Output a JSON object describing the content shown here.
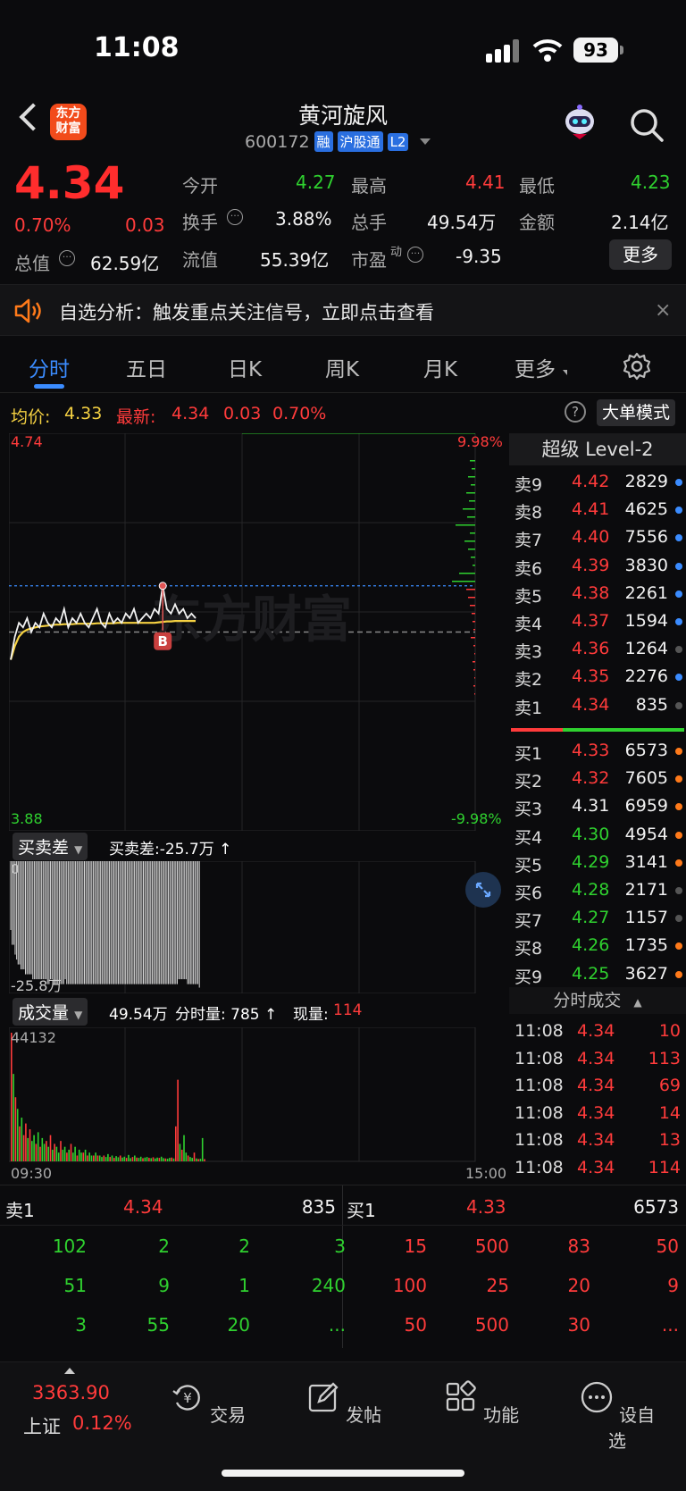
{
  "status": {
    "time": "11:08",
    "battery": "93"
  },
  "header": {
    "logo": "东方财富",
    "name": "黄河旋风",
    "code": "600172",
    "tags": [
      "融",
      "沪股通",
      "L2"
    ]
  },
  "quote": {
    "price": "4.34",
    "pct": "0.70%",
    "chg": "0.03",
    "open_label": "今开",
    "open": "4.27",
    "high_label": "最高",
    "high": "4.41",
    "low_label": "最低",
    "low": "4.23",
    "turnover_label": "换手",
    "turnover": "3.88%",
    "volume_label": "总手",
    "volume": "49.54万",
    "amount_label": "金额",
    "amount": "2.14亿",
    "mcap_label": "总值",
    "mcap": "62.59亿",
    "float_label": "流值",
    "float": "55.39亿",
    "pe_label": "市盈",
    "pe_sup": "动",
    "pe": "-9.35",
    "more": "更多"
  },
  "notice": {
    "text": "自选分析：触发重点关注信号，立即点击查看",
    "close": "×"
  },
  "tabs": [
    "分时",
    "五日",
    "日K",
    "周K",
    "月K",
    "更多"
  ],
  "avgbar": {
    "avg_label": "均价:",
    "avg": "4.33",
    "latest_label": "最新:",
    "latest": "4.34",
    "chg": "0.03",
    "pct": "0.70%",
    "help": "?",
    "big_mode": "大单模式"
  },
  "chart_data": {
    "type": "line",
    "y_top": "4.74",
    "y_bottom": "3.88",
    "pct_top": "9.98%",
    "pct_bottom": "-9.98%",
    "watermark": "东方财富",
    "buy_marker": "B",
    "ylim": [
      3.88,
      4.74
    ],
    "prev_close": 4.31,
    "price": [
      4.25,
      4.3,
      4.33,
      4.32,
      4.34,
      4.31,
      4.33,
      4.32,
      4.35,
      4.33,
      4.32,
      4.34,
      4.33,
      4.36,
      4.32,
      4.34,
      4.33,
      4.35,
      4.33,
      4.32,
      4.34,
      4.36,
      4.33,
      4.32,
      4.35,
      4.33,
      4.34,
      4.33,
      4.35,
      4.34,
      4.36,
      4.33,
      4.34,
      4.35,
      4.34,
      4.36,
      4.35,
      4.41,
      4.36,
      4.35,
      4.37,
      4.35,
      4.36,
      4.34,
      4.35,
      4.34
    ],
    "avg": [
      4.25,
      4.28,
      4.3,
      4.31,
      4.315,
      4.318,
      4.32,
      4.322,
      4.323,
      4.324,
      4.325,
      4.326,
      4.326,
      4.327,
      4.327,
      4.327,
      4.328,
      4.328,
      4.328,
      4.328,
      4.328,
      4.329,
      4.329,
      4.329,
      4.329,
      4.329,
      4.33,
      4.33,
      4.33,
      4.33,
      4.33,
      4.33,
      4.33,
      4.33,
      4.33,
      4.33,
      4.331,
      4.332,
      4.333,
      4.333,
      4.334,
      4.334,
      4.334,
      4.334,
      4.334,
      4.334
    ]
  },
  "diff": {
    "label": "买卖差",
    "text": "买卖差:-25.7万 ↑",
    "top_label": "0",
    "bottom_label": "-25.8万",
    "values": [
      -14,
      -17,
      -17,
      -19,
      -20,
      -21,
      -21,
      -22,
      -22,
      -22,
      -23,
      -23,
      -23,
      -23,
      -23,
      -24,
      -24,
      -24,
      -24,
      -24,
      -24,
      -24,
      -24,
      -24,
      -24,
      -25,
      -25,
      -24,
      -24,
      -25,
      -25,
      -25,
      -25,
      -25,
      -25,
      -25,
      -25,
      -24,
      -25,
      -25,
      -25,
      -25,
      -25,
      -25,
      -25,
      -25,
      -25,
      -25,
      -25,
      -25,
      -25,
      -25,
      -25,
      -25,
      -25,
      -25,
      -25,
      -25,
      -25,
      -25,
      -25,
      -25,
      -25,
      -25,
      -25,
      -25,
      -25,
      -25,
      -25,
      -25,
      -25,
      -25,
      -25,
      -25,
      -25,
      -25,
      -25,
      -25,
      -25,
      -25,
      -25,
      -25,
      -25,
      -25,
      -25,
      -25,
      -25,
      -25,
      -25,
      -25,
      -25,
      -25,
      -25,
      -25,
      -25,
      -25,
      -25,
      -25,
      -25,
      -25,
      -25,
      -25,
      -25,
      -25,
      -25,
      -25,
      -25,
      -25,
      -25,
      -25,
      -25,
      -25,
      -25,
      -25,
      -24,
      -24,
      -24,
      -24,
      -24,
      -24,
      -25,
      -25,
      -25,
      -25,
      -25,
      -25,
      -25,
      -25,
      -25.7
    ]
  },
  "volume": {
    "label": "成交量",
    "text_total": "49.54万",
    "text_seg": "分时量: 785 ↑",
    "text_now_label": "现量:",
    "text_now": "114",
    "max_label": "44132",
    "t_start": "09:30",
    "t_end": "15:00",
    "bars": [
      44132,
      30000,
      22000,
      18000,
      12000,
      15000,
      9000,
      13000,
      8000,
      11000,
      7000,
      9000,
      6000,
      10000,
      5000,
      8000,
      6000,
      7000,
      5000,
      9000,
      4000,
      6000,
      5000,
      3000,
      7000,
      4000,
      5000,
      3000,
      4000,
      6000,
      3000,
      5000,
      2000,
      4000,
      3000,
      3000,
      4000,
      2000,
      3000,
      2000,
      2000,
      3000,
      2000,
      2000,
      1500,
      2000,
      1500,
      2500,
      1500,
      2000,
      1200,
      1800,
      1400,
      2000,
      1300,
      1600,
      1200,
      2200,
      1100,
      1500,
      2000,
      1300,
      1200,
      1600,
      1100,
      1300,
      1500,
      1200,
      1100,
      1400,
      1000,
      1300,
      1200,
      1600,
      1100,
      1000,
      900,
      1200,
      1300,
      1000,
      12000,
      28000,
      6000,
      4000,
      9000,
      3000,
      2000,
      1500,
      1200,
      3000,
      1000,
      800,
      900,
      8000,
      785
    ],
    "dir": [
      1,
      0,
      1,
      0,
      1,
      0,
      1,
      1,
      0,
      1,
      0,
      0,
      1,
      0,
      1,
      0,
      0,
      1,
      0,
      1,
      0,
      1,
      0,
      0,
      1,
      0,
      0,
      1,
      0,
      1,
      0,
      0,
      1,
      0,
      0,
      1,
      0,
      1,
      0,
      0,
      1,
      0,
      1,
      0,
      0,
      1,
      0,
      0,
      1,
      0,
      1,
      0,
      0,
      1,
      0,
      0,
      1,
      0,
      0,
      1,
      0,
      1,
      0,
      0,
      1,
      0,
      0,
      1,
      0,
      1,
      0,
      0,
      1,
      0,
      0,
      1,
      0,
      0,
      1,
      0,
      1,
      1,
      0,
      1,
      0,
      0,
      1,
      0,
      0,
      1,
      0,
      1,
      0,
      0,
      1
    ]
  },
  "level2": {
    "title": "超级 Level-2",
    "asks": [
      {
        "label": "卖9",
        "price": "4.42",
        "vol": "2829",
        "dot": "#3b8cff"
      },
      {
        "label": "卖8",
        "price": "4.41",
        "vol": "4625",
        "dot": "#3b8cff"
      },
      {
        "label": "卖7",
        "price": "4.40",
        "vol": "7556",
        "dot": "#3b8cff"
      },
      {
        "label": "卖6",
        "price": "4.39",
        "vol": "3830",
        "dot": "#3b8cff"
      },
      {
        "label": "卖5",
        "price": "4.38",
        "vol": "2261",
        "dot": "#3b8cff"
      },
      {
        "label": "卖4",
        "price": "4.37",
        "vol": "1594",
        "dot": "#3b8cff"
      },
      {
        "label": "卖3",
        "price": "4.36",
        "vol": "1264",
        "dot": "#555"
      },
      {
        "label": "卖2",
        "price": "4.35",
        "vol": "2276",
        "dot": "#3b8cff"
      },
      {
        "label": "卖1",
        "price": "4.34",
        "vol": "835",
        "dot": "#555"
      }
    ],
    "bids": [
      {
        "label": "买1",
        "price": "4.33",
        "vol": "6573",
        "dot": "#ff7a1a",
        "color": "red"
      },
      {
        "label": "买2",
        "price": "4.32",
        "vol": "7605",
        "dot": "#ff7a1a",
        "color": "red"
      },
      {
        "label": "买3",
        "price": "4.31",
        "vol": "6959",
        "dot": "#ff7a1a",
        "color": "white"
      },
      {
        "label": "买4",
        "price": "4.30",
        "vol": "4954",
        "dot": "#ff7a1a",
        "color": "green"
      },
      {
        "label": "买5",
        "price": "4.29",
        "vol": "3141",
        "dot": "#ff7a1a",
        "color": "green"
      },
      {
        "label": "买6",
        "price": "4.28",
        "vol": "2171",
        "dot": "#555",
        "color": "green"
      },
      {
        "label": "买7",
        "price": "4.27",
        "vol": "1157",
        "dot": "#555",
        "color": "green"
      },
      {
        "label": "买8",
        "price": "4.26",
        "vol": "1735",
        "dot": "#ff7a1a",
        "color": "green"
      },
      {
        "label": "买9",
        "price": "4.25",
        "vol": "3627",
        "dot": "#ff7a1a",
        "color": "green"
      }
    ],
    "trades_title": "分时成交",
    "trades": [
      {
        "time": "11:08",
        "price": "4.34",
        "vol": "10"
      },
      {
        "time": "11:08",
        "price": "4.34",
        "vol": "113"
      },
      {
        "time": "11:08",
        "price": "4.34",
        "vol": "69"
      },
      {
        "time": "11:08",
        "price": "4.34",
        "vol": "14"
      },
      {
        "time": "11:08",
        "price": "4.34",
        "vol": "13"
      },
      {
        "time": "11:08",
        "price": "4.34",
        "vol": "114"
      }
    ]
  },
  "bottom_book": {
    "ask_label": "卖1",
    "ask_price": "4.34",
    "ask_vol": "835",
    "bid_label": "买1",
    "bid_price": "4.33",
    "bid_vol": "6573",
    "ask_rows": [
      [
        "102",
        "2",
        "2",
        "3"
      ],
      [
        "51",
        "9",
        "1",
        "240"
      ],
      [
        "3",
        "55",
        "20",
        "..."
      ]
    ],
    "bid_rows": [
      [
        "15",
        "500",
        "83",
        "50"
      ],
      [
        "100",
        "25",
        "20",
        "9"
      ],
      [
        "50",
        "500",
        "30",
        "..."
      ]
    ]
  },
  "nav": {
    "index_value": "3363.90",
    "index_name": "上证",
    "index_pct": "0.12%",
    "items": [
      "交易",
      "发帖",
      "功能",
      "设自选"
    ]
  }
}
